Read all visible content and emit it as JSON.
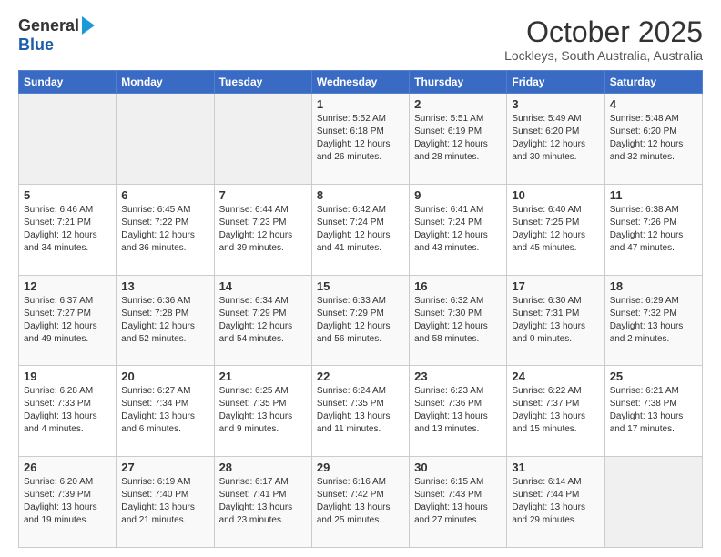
{
  "header": {
    "logo_general": "General",
    "logo_blue": "Blue",
    "month_title": "October 2025",
    "location": "Lockleys, South Australia, Australia"
  },
  "calendar": {
    "days_of_week": [
      "Sunday",
      "Monday",
      "Tuesday",
      "Wednesday",
      "Thursday",
      "Friday",
      "Saturday"
    ],
    "rows": [
      [
        {
          "day": "",
          "info": ""
        },
        {
          "day": "",
          "info": ""
        },
        {
          "day": "",
          "info": ""
        },
        {
          "day": "1",
          "info": "Sunrise: 5:52 AM\nSunset: 6:18 PM\nDaylight: 12 hours\nand 26 minutes."
        },
        {
          "day": "2",
          "info": "Sunrise: 5:51 AM\nSunset: 6:19 PM\nDaylight: 12 hours\nand 28 minutes."
        },
        {
          "day": "3",
          "info": "Sunrise: 5:49 AM\nSunset: 6:20 PM\nDaylight: 12 hours\nand 30 minutes."
        },
        {
          "day": "4",
          "info": "Sunrise: 5:48 AM\nSunset: 6:20 PM\nDaylight: 12 hours\nand 32 minutes."
        }
      ],
      [
        {
          "day": "5",
          "info": "Sunrise: 6:46 AM\nSunset: 7:21 PM\nDaylight: 12 hours\nand 34 minutes."
        },
        {
          "day": "6",
          "info": "Sunrise: 6:45 AM\nSunset: 7:22 PM\nDaylight: 12 hours\nand 36 minutes."
        },
        {
          "day": "7",
          "info": "Sunrise: 6:44 AM\nSunset: 7:23 PM\nDaylight: 12 hours\nand 39 minutes."
        },
        {
          "day": "8",
          "info": "Sunrise: 6:42 AM\nSunset: 7:24 PM\nDaylight: 12 hours\nand 41 minutes."
        },
        {
          "day": "9",
          "info": "Sunrise: 6:41 AM\nSunset: 7:24 PM\nDaylight: 12 hours\nand 43 minutes."
        },
        {
          "day": "10",
          "info": "Sunrise: 6:40 AM\nSunset: 7:25 PM\nDaylight: 12 hours\nand 45 minutes."
        },
        {
          "day": "11",
          "info": "Sunrise: 6:38 AM\nSunset: 7:26 PM\nDaylight: 12 hours\nand 47 minutes."
        }
      ],
      [
        {
          "day": "12",
          "info": "Sunrise: 6:37 AM\nSunset: 7:27 PM\nDaylight: 12 hours\nand 49 minutes."
        },
        {
          "day": "13",
          "info": "Sunrise: 6:36 AM\nSunset: 7:28 PM\nDaylight: 12 hours\nand 52 minutes."
        },
        {
          "day": "14",
          "info": "Sunrise: 6:34 AM\nSunset: 7:29 PM\nDaylight: 12 hours\nand 54 minutes."
        },
        {
          "day": "15",
          "info": "Sunrise: 6:33 AM\nSunset: 7:29 PM\nDaylight: 12 hours\nand 56 minutes."
        },
        {
          "day": "16",
          "info": "Sunrise: 6:32 AM\nSunset: 7:30 PM\nDaylight: 12 hours\nand 58 minutes."
        },
        {
          "day": "17",
          "info": "Sunrise: 6:30 AM\nSunset: 7:31 PM\nDaylight: 13 hours\nand 0 minutes."
        },
        {
          "day": "18",
          "info": "Sunrise: 6:29 AM\nSunset: 7:32 PM\nDaylight: 13 hours\nand 2 minutes."
        }
      ],
      [
        {
          "day": "19",
          "info": "Sunrise: 6:28 AM\nSunset: 7:33 PM\nDaylight: 13 hours\nand 4 minutes."
        },
        {
          "day": "20",
          "info": "Sunrise: 6:27 AM\nSunset: 7:34 PM\nDaylight: 13 hours\nand 6 minutes."
        },
        {
          "day": "21",
          "info": "Sunrise: 6:25 AM\nSunset: 7:35 PM\nDaylight: 13 hours\nand 9 minutes."
        },
        {
          "day": "22",
          "info": "Sunrise: 6:24 AM\nSunset: 7:35 PM\nDaylight: 13 hours\nand 11 minutes."
        },
        {
          "day": "23",
          "info": "Sunrise: 6:23 AM\nSunset: 7:36 PM\nDaylight: 13 hours\nand 13 minutes."
        },
        {
          "day": "24",
          "info": "Sunrise: 6:22 AM\nSunset: 7:37 PM\nDaylight: 13 hours\nand 15 minutes."
        },
        {
          "day": "25",
          "info": "Sunrise: 6:21 AM\nSunset: 7:38 PM\nDaylight: 13 hours\nand 17 minutes."
        }
      ],
      [
        {
          "day": "26",
          "info": "Sunrise: 6:20 AM\nSunset: 7:39 PM\nDaylight: 13 hours\nand 19 minutes."
        },
        {
          "day": "27",
          "info": "Sunrise: 6:19 AM\nSunset: 7:40 PM\nDaylight: 13 hours\nand 21 minutes."
        },
        {
          "day": "28",
          "info": "Sunrise: 6:17 AM\nSunset: 7:41 PM\nDaylight: 13 hours\nand 23 minutes."
        },
        {
          "day": "29",
          "info": "Sunrise: 6:16 AM\nSunset: 7:42 PM\nDaylight: 13 hours\nand 25 minutes."
        },
        {
          "day": "30",
          "info": "Sunrise: 6:15 AM\nSunset: 7:43 PM\nDaylight: 13 hours\nand 27 minutes."
        },
        {
          "day": "31",
          "info": "Sunrise: 6:14 AM\nSunset: 7:44 PM\nDaylight: 13 hours\nand 29 minutes."
        },
        {
          "day": "",
          "info": ""
        }
      ]
    ]
  }
}
